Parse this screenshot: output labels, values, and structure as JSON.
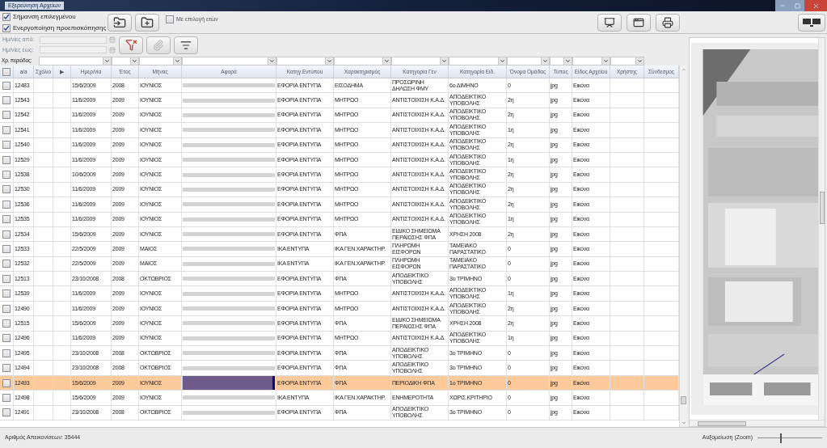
{
  "window": {
    "title": "Εξερεύνηση Αρχείων"
  },
  "options": [
    {
      "label": "Σήμανση επιλεγμένου",
      "checked": true
    },
    {
      "label": "Ενεργοποίηση προεπισκόπησης",
      "checked": true
    }
  ],
  "year_selection": {
    "label": "Με επιλογή ετών",
    "checked": false
  },
  "date_from": {
    "label": "Ημ/νίες από:",
    "disabled": true
  },
  "date_to": {
    "label": "Ημ/νίες έως:",
    "disabled": true
  },
  "period_label": "Χρ. περιόδος:",
  "table": {
    "select_all_checked": false,
    "columns": [
      {
        "label": "a/a",
        "has_filter": false
      },
      {
        "label": "Σχόλιο",
        "has_filter": false
      },
      {
        "label": "▶",
        "has_filter": false
      },
      {
        "label": "Ημερ/νία",
        "has_filter": true
      },
      {
        "label": "Έτος",
        "has_filter": true
      },
      {
        "label": "Μήνας",
        "has_filter": true
      },
      {
        "label": "Αφορά",
        "has_filter": true
      },
      {
        "label": "Κατηγ.Εντύπου",
        "has_filter": true
      },
      {
        "label": "Χαρακτηρισμός",
        "has_filter": true
      },
      {
        "label": "Κατηγορία Γεν",
        "has_filter": true
      },
      {
        "label": "Κατηγορία Ειδ.",
        "has_filter": true
      },
      {
        "label": "Όνομα Ομάδας",
        "has_filter": true
      },
      {
        "label": "Τύπος",
        "has_filter": true
      },
      {
        "label": "Είδος Αρχείου",
        "has_filter": true
      },
      {
        "label": "Χρήστης",
        "has_filter": true
      },
      {
        "label": "Σύνδεσμος",
        "has_filter": false
      }
    ],
    "rows": [
      {
        "checked": false,
        "selected": false,
        "cells": [
          "12483",
          "",
          "",
          "15/6/2009",
          "2008",
          "ΙΟΥΝΙΟΣ",
          "",
          "ΕΦΟΡΙΑ ΕΝΤΥΠΑ",
          "ΕΙΣΟΔΗΜΑ",
          "ΠΡΟΣΩΡΙΝΗ ΔΗΛΩΣΗ ΦΜΥ",
          "6ο ΔΙΜΗΝΟ",
          "0",
          "jpg",
          "Εικόνα",
          "",
          ""
        ]
      },
      {
        "checked": false,
        "selected": false,
        "cells": [
          "12543",
          "",
          "",
          "11/6/2009",
          "2009",
          "ΙΟΥΝΙΟΣ",
          "",
          "ΕΦΟΡΙΑ ΕΝΤΥΠΑ",
          "ΜΗΤΡΩΟ",
          "ΑΝΤΙΣΤΟΙΧΙΣΗ Κ.Α.Δ.",
          "ΑΠΟΔΕΙΚΤΙΚΟ ΥΠΟΒΟΛΗΣ",
          "2η",
          "jpg",
          "Εικόνα",
          "",
          ""
        ]
      },
      {
        "checked": false,
        "selected": false,
        "cells": [
          "12542",
          "",
          "",
          "11/6/2009",
          "2009",
          "ΙΟΥΝΙΟΣ",
          "",
          "ΕΦΟΡΙΑ ΕΝΤΥΠΑ",
          "ΜΗΤΡΩΟ",
          "ΑΝΤΙΣΤΟΙΧΙΣΗ Κ.Α.Δ.",
          "ΑΠΟΔΕΙΚΤΙΚΟ ΥΠΟΒΟΛΗΣ",
          "2η",
          "jpg",
          "Εικόνα",
          "",
          ""
        ]
      },
      {
        "checked": false,
        "selected": false,
        "cells": [
          "12541",
          "",
          "",
          "11/6/2009",
          "2009",
          "ΙΟΥΝΙΟΣ",
          "",
          "ΕΦΟΡΙΑ ΕΝΤΥΠΑ",
          "ΜΗΤΡΩΟ",
          "ΑΝΤΙΣΤΟΙΧΙΣΗ Κ.Α.Δ.",
          "ΑΠΟΔΕΙΚΤΙΚΟ ΥΠΟΒΟΛΗΣ",
          "1η",
          "jpg",
          "Εικόνα",
          "",
          ""
        ]
      },
      {
        "checked": false,
        "selected": false,
        "cells": [
          "12540",
          "",
          "",
          "11/6/2009",
          "2009",
          "ΙΟΥΝΙΟΣ",
          "",
          "ΕΦΟΡΙΑ ΕΝΤΥΠΑ",
          "ΜΗΤΡΩΟ",
          "ΑΝΤΙΣΤΟΙΧΙΣΗ Κ.Α.Δ.",
          "ΑΠΟΔΕΙΚΤΙΚΟ ΥΠΟΒΟΛΗΣ",
          "2η",
          "jpg",
          "Εικόνα",
          "",
          ""
        ]
      },
      {
        "checked": false,
        "selected": false,
        "cells": [
          "12529",
          "",
          "",
          "11/6/2009",
          "2009",
          "ΙΟΥΝΙΟΣ",
          "",
          "ΕΦΟΡΙΑ ΕΝΤΥΠΑ",
          "ΜΗΤΡΩΟ",
          "ΑΝΤΙΣΤΟΙΧΙΣΗ Κ.Α.Δ.",
          "ΑΠΟΔΕΙΚΤΙΚΟ ΥΠΟΒΟΛΗΣ",
          "1η",
          "jpg",
          "Εικόνα",
          "",
          ""
        ]
      },
      {
        "checked": false,
        "selected": false,
        "cells": [
          "12538",
          "",
          "",
          "10/6/2009",
          "2009",
          "ΙΟΥΝΙΟΣ",
          "",
          "ΕΦΟΡΙΑ ΕΝΤΥΠΑ",
          "ΜΗΤΡΩΟ",
          "ΑΝΤΙΣΤΟΙΧΙΣΗ Κ.Α.Δ.",
          "ΑΠΟΔΕΙΚΤΙΚΟ ΥΠΟΒΟΛΗΣ",
          "2η",
          "jpg",
          "Εικόνα",
          "",
          ""
        ]
      },
      {
        "checked": false,
        "selected": false,
        "cells": [
          "12530",
          "",
          "",
          "11/6/2009",
          "2009",
          "ΙΟΥΝΙΟΣ",
          "",
          "ΕΦΟΡΙΑ ΕΝΤΥΠΑ",
          "ΜΗΤΡΩΟ",
          "ΑΝΤΙΣΤΟΙΧΙΣΗ Κ.Α.Δ.",
          "ΑΠΟΔΕΙΚΤΙΚΟ ΥΠΟΒΟΛΗΣ",
          "2η",
          "jpg",
          "Εικόνα",
          "",
          ""
        ]
      },
      {
        "checked": false,
        "selected": false,
        "cells": [
          "12536",
          "",
          "",
          "11/6/2009",
          "2009",
          "ΙΟΥΝΙΟΣ",
          "",
          "ΕΦΟΡΙΑ ΕΝΤΥΠΑ",
          "ΜΗΤΡΩΟ",
          "ΑΝΤΙΣΤΟΙΧΙΣΗ Κ.Α.Δ.",
          "ΑΠΟΔΕΙΚΤΙΚΟ ΥΠΟΒΟΛΗΣ",
          "2η",
          "jpg",
          "Εικόνα",
          "",
          ""
        ]
      },
      {
        "checked": false,
        "selected": false,
        "cells": [
          "12535",
          "",
          "",
          "11/6/2009",
          "2009",
          "ΙΟΥΝΙΟΣ",
          "",
          "ΕΦΟΡΙΑ ΕΝΤΥΠΑ",
          "ΜΗΤΡΩΟ",
          "ΑΝΤΙΣΤΟΙΧΙΣΗ Κ.Α.Δ.",
          "ΑΠΟΔΕΙΚΤΙΚΟ ΥΠΟΒΟΛΗΣ",
          "1η",
          "jpg",
          "Εικόνα",
          "",
          ""
        ]
      },
      {
        "checked": false,
        "selected": false,
        "cells": [
          "12534",
          "",
          "",
          "15/6/2009",
          "2009",
          "ΙΟΥΝΙΟΣ",
          "",
          "ΕΦΟΡΙΑ ΕΝΤΥΠΑ",
          "ΦΠΑ",
          "ΕΙΔΙΚΟ ΣΗΜΕΙΩΜΑ ΠΕΡΑΙΩΣΗΣ ΦΠΑ",
          "ΧΡΗΣΗ 2008",
          "2η",
          "jpg",
          "Εικόνα",
          "",
          ""
        ]
      },
      {
        "checked": false,
        "selected": false,
        "cells": [
          "12533",
          "",
          "",
          "22/5/2009",
          "2009",
          "ΜΑΙΟΣ",
          "",
          "ΙΚΑ ΕΝΤΥΠΑ",
          "ΙΚΑ ΓΕΝ.ΧΑΡΑΚΤΗΡ.",
          "ΠΛΗΡΩΜΗ ΕΙΣΦΟΡΩΝ",
          "ΤΑΜΕΙΑΚΟ ΠΑΡΑΣΤΑΤΙΚΟ",
          "0",
          "jpg",
          "Εικόνα",
          "",
          ""
        ]
      },
      {
        "checked": false,
        "selected": false,
        "cells": [
          "12532",
          "",
          "",
          "22/5/2009",
          "2009",
          "ΜΑΙΟΣ",
          "",
          "ΙΚΑ ΕΝΤΥΠΑ",
          "ΙΚΑ ΓΕΝ.ΧΑΡΑΚΤΗΡ.",
          "ΠΛΗΡΩΜΗ ΕΙΣΦΟΡΩΝ",
          "ΤΑΜΕΙΑΚΟ ΠΑΡΑΣΤΑΤΙΚΟ",
          "0",
          "jpg",
          "Εικόνα",
          "",
          ""
        ]
      },
      {
        "checked": false,
        "selected": false,
        "cells": [
          "12513",
          "",
          "",
          "23/10/2008",
          "2008",
          "ΟΚΤΩΒΡΙΟΣ",
          "",
          "ΕΦΟΡΙΑ ΕΝΤΥΠΑ",
          "ΦΠΑ",
          "ΑΠΟΔΕΙΚΤΙΚΟ ΥΠΟΒΟΛΗΣ",
          "3ο ΤΡΙΜΗΝΟ",
          "0",
          "jpg",
          "Εικόνα",
          "",
          ""
        ]
      },
      {
        "checked": false,
        "selected": false,
        "cells": [
          "12539",
          "",
          "",
          "11/6/2009",
          "2009",
          "ΙΟΥΝΙΟΣ",
          "",
          "ΕΦΟΡΙΑ ΕΝΤΥΠΑ",
          "ΜΗΤΡΩΟ",
          "ΑΝΤΙΣΤΟΙΧΙΣΗ Κ.Α.Δ.",
          "ΑΠΟΔΕΙΚΤΙΚΟ ΥΠΟΒΟΛΗΣ",
          "1η",
          "jpg",
          "Εικόνα",
          "",
          ""
        ]
      },
      {
        "checked": false,
        "selected": false,
        "cells": [
          "12490",
          "",
          "",
          "11/6/2009",
          "2009",
          "ΙΟΥΝΙΟΣ",
          "",
          "ΕΦΟΡΙΑ ΕΝΤΥΠΑ",
          "ΜΗΤΡΩΟ",
          "ΑΝΤΙΣΤΟΙΧΙΣΗ Κ.Α.Δ.",
          "ΑΠΟΔΕΙΚΤΙΚΟ ΥΠΟΒΟΛΗΣ",
          "2η",
          "jpg",
          "Εικόνα",
          "",
          ""
        ]
      },
      {
        "checked": false,
        "selected": false,
        "cells": [
          "12515",
          "",
          "",
          "15/6/2009",
          "2009",
          "ΙΟΥΝΙΟΣ",
          "",
          "ΕΦΟΡΙΑ ΕΝΤΥΠΑ",
          "ΦΠΑ",
          "ΕΙΔΙΚΟ ΣΗΜΕΙΩΜΑ ΠΕΡΑΙΩΣΗΣ ΦΠΑ",
          "ΧΡΗΣΗ 2008",
          "2η",
          "jpg",
          "Εικόνα",
          "",
          ""
        ]
      },
      {
        "checked": false,
        "selected": false,
        "cells": [
          "12496",
          "",
          "",
          "11/6/2009",
          "2009",
          "ΙΟΥΝΙΟΣ",
          "",
          "ΕΦΟΡΙΑ ΕΝΤΥΠΑ",
          "ΜΗΤΡΩΟ",
          "ΑΝΤΙΣΤΟΙΧΙΣΗ Κ.Α.Δ.",
          "ΑΠΟΔΕΙΚΤΙΚΟ ΥΠΟΒΟΛΗΣ",
          "1η",
          "jpg",
          "Εικόνα",
          "",
          ""
        ]
      },
      {
        "checked": false,
        "selected": false,
        "cells": [
          "12495",
          "",
          "",
          "23/10/2008",
          "2008",
          "ΟΚΤΩΒΡΙΟΣ",
          "",
          "ΕΦΟΡΙΑ ΕΝΤΥΠΑ",
          "ΦΠΑ",
          "ΑΠΟΔΕΙΚΤΙΚΟ ΥΠΟΒΟΛΗΣ",
          "3ο ΤΡΙΜΗΝΟ",
          "0",
          "jpg",
          "Εικόνα",
          "",
          ""
        ]
      },
      {
        "checked": false,
        "selected": false,
        "cells": [
          "12494",
          "",
          "",
          "23/10/2008",
          "2008",
          "ΟΚΤΩΒΡΙΟΣ",
          "",
          "ΕΦΟΡΙΑ ΕΝΤΥΠΑ",
          "ΦΠΑ",
          "ΑΠΟΔΕΙΚΤΙΚΟ ΥΠΟΒΟΛΗΣ",
          "3ο ΤΡΙΜΗΝΟ",
          "0",
          "jpg",
          "Εικόνα",
          "",
          ""
        ]
      },
      {
        "checked": false,
        "selected": true,
        "cells": [
          "12493",
          "",
          "",
          "15/6/2009",
          "2009",
          "ΙΟΥΝΙΟΣ",
          "",
          "ΕΦΟΡΙΑ ΕΝΤΥΠΑ",
          "ΦΠΑ",
          "ΠΕΡΙΟΔΙΚΗ ΦΠΑ",
          "1ο ΤΡΙΜΗΝΟ",
          "0",
          "jpg",
          "Εικόνα",
          "",
          ""
        ]
      },
      {
        "checked": false,
        "selected": false,
        "cells": [
          "12498",
          "",
          "",
          "15/6/2009",
          "2009",
          "ΙΟΥΝΙΟΣ",
          "",
          "ΙΚΑ ΕΝΤΥΠΑ",
          "ΙΚΑ ΓΕΝ.ΧΑΡΑΚΤΗΡ.",
          "ΕΝΗΜΕΡΟΤΗΤΑ",
          "ΧΩΡΙΣ ΚΡΙΤΗΡΙΟ",
          "0",
          "jpg",
          "Εικόνα",
          "",
          ""
        ]
      },
      {
        "checked": false,
        "selected": false,
        "cells": [
          "12491",
          "",
          "",
          "23/10/2008",
          "2008",
          "ΟΚΤΩΒΡΙΟΣ",
          "",
          "ΕΦΟΡΙΑ ΕΝΤΥΠΑ",
          "ΦΠΑ",
          "ΑΠΟΔΕΙΚΤΙΚΟ ΥΠΟΒΟΛΗΣ",
          "3ο ΤΡΙΜΗΝΟ",
          "0",
          "jpg",
          "Εικόνα",
          "",
          ""
        ]
      }
    ]
  },
  "status_bar": {
    "count": "Αριθμός Απεικονίσεων: 35444",
    "zoom_label": "Αυξομείωση (Zoom)",
    "zoom": {
      "level": 0.35
    }
  }
}
